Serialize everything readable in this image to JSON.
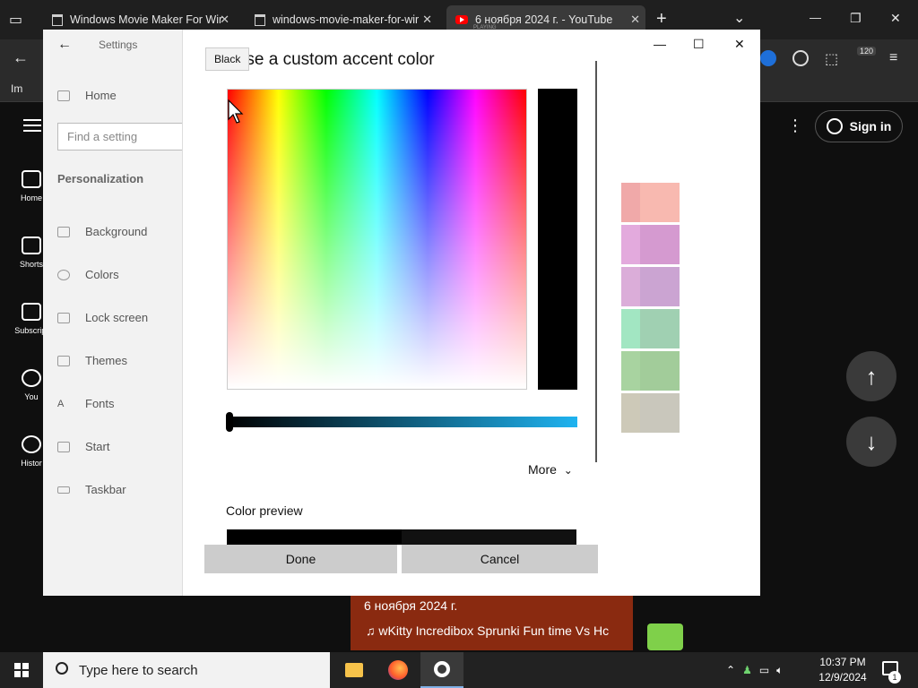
{
  "browser": {
    "tabs": [
      {
        "title": "Windows Movie Maker For Wir",
        "close": "✕"
      },
      {
        "title": "windows-movie-maker-for-wir",
        "close": "✕"
      },
      {
        "title": "6 ноября 2024 г. - YouTube",
        "subtitle": "PLAYING",
        "close": "✕"
      }
    ],
    "new_tab": "+",
    "tab_list": "⌄",
    "minimize": "—",
    "restore": "❐",
    "close": "✕",
    "bookmark": "Im",
    "back": "←",
    "extension_badge": "120"
  },
  "youtube": {
    "nav": [
      {
        "label": "Home"
      },
      {
        "label": "Shorts"
      },
      {
        "label": "Subscript"
      },
      {
        "label": "You"
      },
      {
        "label": "Histor"
      }
    ],
    "sign_in": "Sign in",
    "menu": "⋮",
    "scroll_up": "↑",
    "scroll_down": "↓",
    "video_date": "6 ноября 2024 г.",
    "now_playing": "♫ wKitty    Incredibox Sprunki Fun time Vs Hc"
  },
  "settings": {
    "title": "Settings",
    "back": "←",
    "home": "Home",
    "find_placeholder": "Find a setting",
    "category": "Personalization",
    "items": [
      {
        "label": "Background"
      },
      {
        "label": "Colors"
      },
      {
        "label": "Lock screen"
      },
      {
        "label": "Themes"
      },
      {
        "label": "Fonts"
      },
      {
        "label": "Start"
      },
      {
        "label": "Taskbar"
      }
    ],
    "window_controls": {
      "minimize": "—",
      "maximize": "☐",
      "close": "✕"
    },
    "swatch_colors": [
      "#f0a9a9",
      "#f8b9b0",
      "#e3aadd",
      "#d59ad0",
      "#dbadd9",
      "#cba4d2",
      "#a2e6c2",
      "#a0d0b2",
      "#a8d3a0",
      "#a2cc9a",
      "#cdc9b8",
      "#c9c7bc"
    ]
  },
  "dialog": {
    "tooltip": "Black",
    "title": "Choose a custom accent color",
    "more": "More",
    "preview_label": "Color preview",
    "done": "Done",
    "cancel": "Cancel",
    "selected_color": "#000000"
  },
  "taskbar": {
    "search_placeholder": "Type here to search",
    "time": "10:37 PM",
    "date": "12/9/2024",
    "notifications": "1"
  }
}
